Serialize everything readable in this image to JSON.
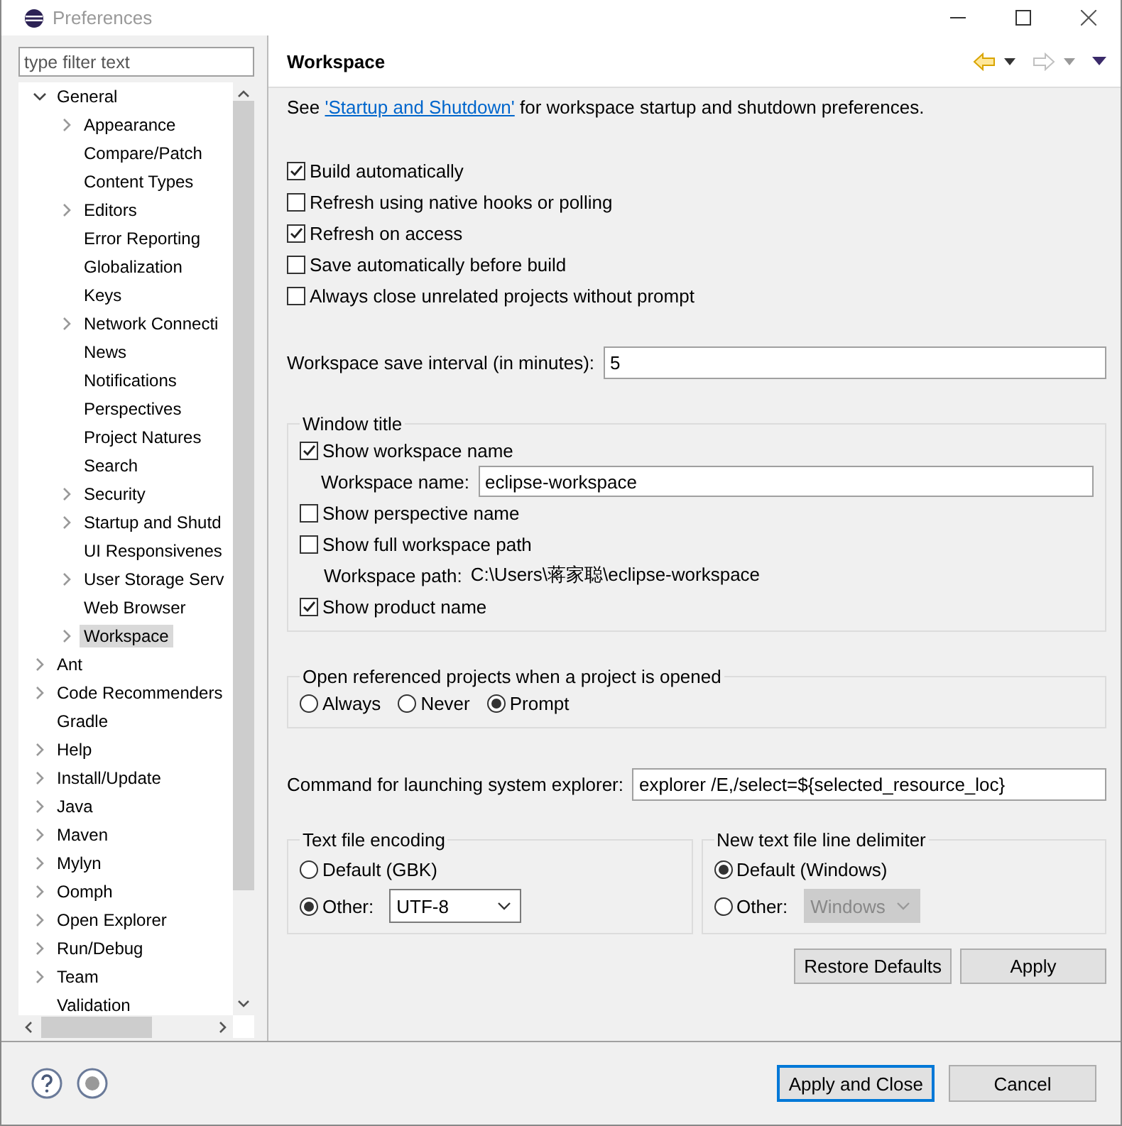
{
  "window": {
    "title": "Preferences"
  },
  "filter": {
    "placeholder": "type filter text"
  },
  "tree": [
    {
      "label": "General",
      "expandable": true,
      "expanded": true,
      "selected": false,
      "children": [
        {
          "label": "Appearance",
          "expandable": true,
          "expanded": false,
          "selected": false
        },
        {
          "label": "Compare/Patch",
          "expandable": false,
          "expanded": false,
          "selected": false
        },
        {
          "label": "Content Types",
          "expandable": false,
          "expanded": false,
          "selected": false
        },
        {
          "label": "Editors",
          "expandable": true,
          "expanded": false,
          "selected": false
        },
        {
          "label": "Error Reporting",
          "expandable": false,
          "expanded": false,
          "selected": false
        },
        {
          "label": "Globalization",
          "expandable": false,
          "expanded": false,
          "selected": false
        },
        {
          "label": "Keys",
          "expandable": false,
          "expanded": false,
          "selected": false
        },
        {
          "label": "Network Connecti",
          "expandable": true,
          "expanded": false,
          "selected": false
        },
        {
          "label": "News",
          "expandable": false,
          "expanded": false,
          "selected": false
        },
        {
          "label": "Notifications",
          "expandable": false,
          "expanded": false,
          "selected": false
        },
        {
          "label": "Perspectives",
          "expandable": false,
          "expanded": false,
          "selected": false
        },
        {
          "label": "Project Natures",
          "expandable": false,
          "expanded": false,
          "selected": false
        },
        {
          "label": "Search",
          "expandable": false,
          "expanded": false,
          "selected": false
        },
        {
          "label": "Security",
          "expandable": true,
          "expanded": false,
          "selected": false
        },
        {
          "label": "Startup and Shutd",
          "expandable": true,
          "expanded": false,
          "selected": false
        },
        {
          "label": "UI Responsivenes",
          "expandable": false,
          "expanded": false,
          "selected": false
        },
        {
          "label": "User Storage Serv",
          "expandable": true,
          "expanded": false,
          "selected": false
        },
        {
          "label": "Web Browser",
          "expandable": false,
          "expanded": false,
          "selected": false
        },
        {
          "label": "Workspace",
          "expandable": true,
          "expanded": false,
          "selected": true
        }
      ]
    },
    {
      "label": "Ant",
      "expandable": true,
      "expanded": false,
      "selected": false
    },
    {
      "label": "Code Recommenders",
      "expandable": true,
      "expanded": false,
      "selected": false
    },
    {
      "label": "Gradle",
      "expandable": false,
      "expanded": false,
      "selected": false
    },
    {
      "label": "Help",
      "expandable": true,
      "expanded": false,
      "selected": false
    },
    {
      "label": "Install/Update",
      "expandable": true,
      "expanded": false,
      "selected": false
    },
    {
      "label": "Java",
      "expandable": true,
      "expanded": false,
      "selected": false
    },
    {
      "label": "Maven",
      "expandable": true,
      "expanded": false,
      "selected": false
    },
    {
      "label": "Mylyn",
      "expandable": true,
      "expanded": false,
      "selected": false
    },
    {
      "label": "Oomph",
      "expandable": true,
      "expanded": false,
      "selected": false
    },
    {
      "label": "Open Explorer",
      "expandable": true,
      "expanded": false,
      "selected": false
    },
    {
      "label": "Run/Debug",
      "expandable": true,
      "expanded": false,
      "selected": false
    },
    {
      "label": "Team",
      "expandable": true,
      "expanded": false,
      "selected": false
    },
    {
      "label": "Validation",
      "expandable": false,
      "expanded": false,
      "selected": false
    }
  ],
  "page": {
    "title": "Workspace",
    "intro_before": "See ",
    "intro_link": "'Startup and Shutdown'",
    "intro_after": " for workspace startup and shutdown preferences."
  },
  "options": [
    {
      "label": "Build automatically",
      "checked": true
    },
    {
      "label": "Refresh using native hooks or polling",
      "checked": false
    },
    {
      "label": "Refresh on access",
      "checked": true
    },
    {
      "label": "Save automatically before build",
      "checked": false
    },
    {
      "label": "Always close unrelated projects without prompt",
      "checked": false
    }
  ],
  "save_interval": {
    "label": "Workspace save interval (in minutes):",
    "value": "5"
  },
  "window_title_group": {
    "title": "Window title",
    "items": [
      {
        "kind": "checkbox",
        "label": "Show workspace name",
        "checked": true
      },
      {
        "kind": "field",
        "label": "Workspace name:",
        "value": "eclipse-workspace"
      },
      {
        "kind": "checkbox",
        "label": "Show perspective name",
        "checked": false
      },
      {
        "kind": "checkbox",
        "label": "Show full workspace path",
        "checked": false
      },
      {
        "kind": "text",
        "label": "Workspace path:",
        "value": "C:\\Users\\蒋家聪\\eclipse-workspace"
      },
      {
        "kind": "checkbox",
        "label": "Show product name",
        "checked": true
      }
    ]
  },
  "open_referenced": {
    "title": "Open referenced projects when a project is opened",
    "options": [
      {
        "label": "Always",
        "selected": false
      },
      {
        "label": "Never",
        "selected": false
      },
      {
        "label": "Prompt",
        "selected": true
      }
    ]
  },
  "explorer_command": {
    "label": "Command for launching system explorer:",
    "value": "explorer /E,/select=${selected_resource_loc}"
  },
  "encoding": {
    "title": "Text file encoding",
    "options": [
      {
        "label": "Default (GBK)",
        "selected": false
      },
      {
        "label": "Other:",
        "selected": true,
        "dropdown": {
          "value": "UTF-8",
          "disabled": false
        }
      }
    ]
  },
  "line_delimiter": {
    "title": "New text file line delimiter",
    "options": [
      {
        "label": "Default (Windows)",
        "selected": true
      },
      {
        "label": "Other:",
        "selected": false,
        "dropdown": {
          "value": "Windows",
          "disabled": true
        }
      }
    ]
  },
  "page_buttons": [
    {
      "label": "Restore Defaults"
    },
    {
      "label": "Apply"
    }
  ],
  "footer_buttons": [
    {
      "label": "Apply and Close",
      "default": true
    },
    {
      "label": "Cancel",
      "default": false
    }
  ]
}
